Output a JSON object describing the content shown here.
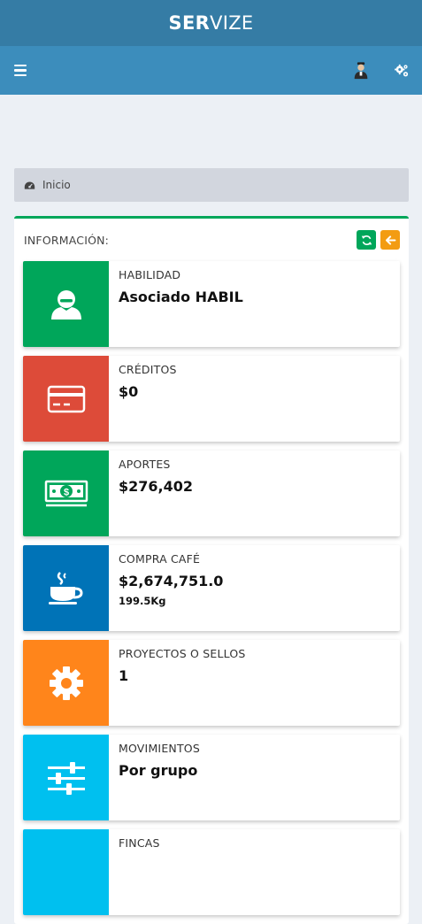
{
  "logo": {
    "bold": "SER",
    "light": "VIZE"
  },
  "navbar": {
    "menu_icon": "bars-icon",
    "user_icon": "avatar",
    "settings_icon": "cogs-icon"
  },
  "breadcrumb": {
    "icon": "dashboard-icon",
    "label": "Inicio"
  },
  "box": {
    "title": "INFORMACIÓN:",
    "refresh_icon": "refresh-icon",
    "back_icon": "arrow-left-icon"
  },
  "cards": [
    {
      "label": "HABILIDAD",
      "value": "Asociado HABIL",
      "sub": "",
      "icon": "user-icon",
      "color": "#00a65a"
    },
    {
      "label": "CRÉDITOS",
      "value": "$0",
      "sub": "",
      "icon": "credit-card-icon",
      "color": "#dd4b39"
    },
    {
      "label": "APORTES",
      "value": "$276,402",
      "sub": "",
      "icon": "money-icon",
      "color": "#00a65a"
    },
    {
      "label": "COMPRA CAFÉ",
      "value": "$2,674,751.0",
      "sub": "199.5Kg",
      "icon": "coffee-icon",
      "color": "#0073b7"
    },
    {
      "label": "PROYECTOS O SELLOS",
      "value": "1",
      "sub": "",
      "icon": "gear-icon",
      "color": "#ff851b"
    },
    {
      "label": "MOVIMIENTOS",
      "value": "Por grupo",
      "sub": "",
      "icon": "sliders-icon",
      "color": "#00c0ef"
    },
    {
      "label": "FINCAS",
      "value": "",
      "sub": "",
      "icon": "",
      "color": "#00c0ef"
    }
  ]
}
